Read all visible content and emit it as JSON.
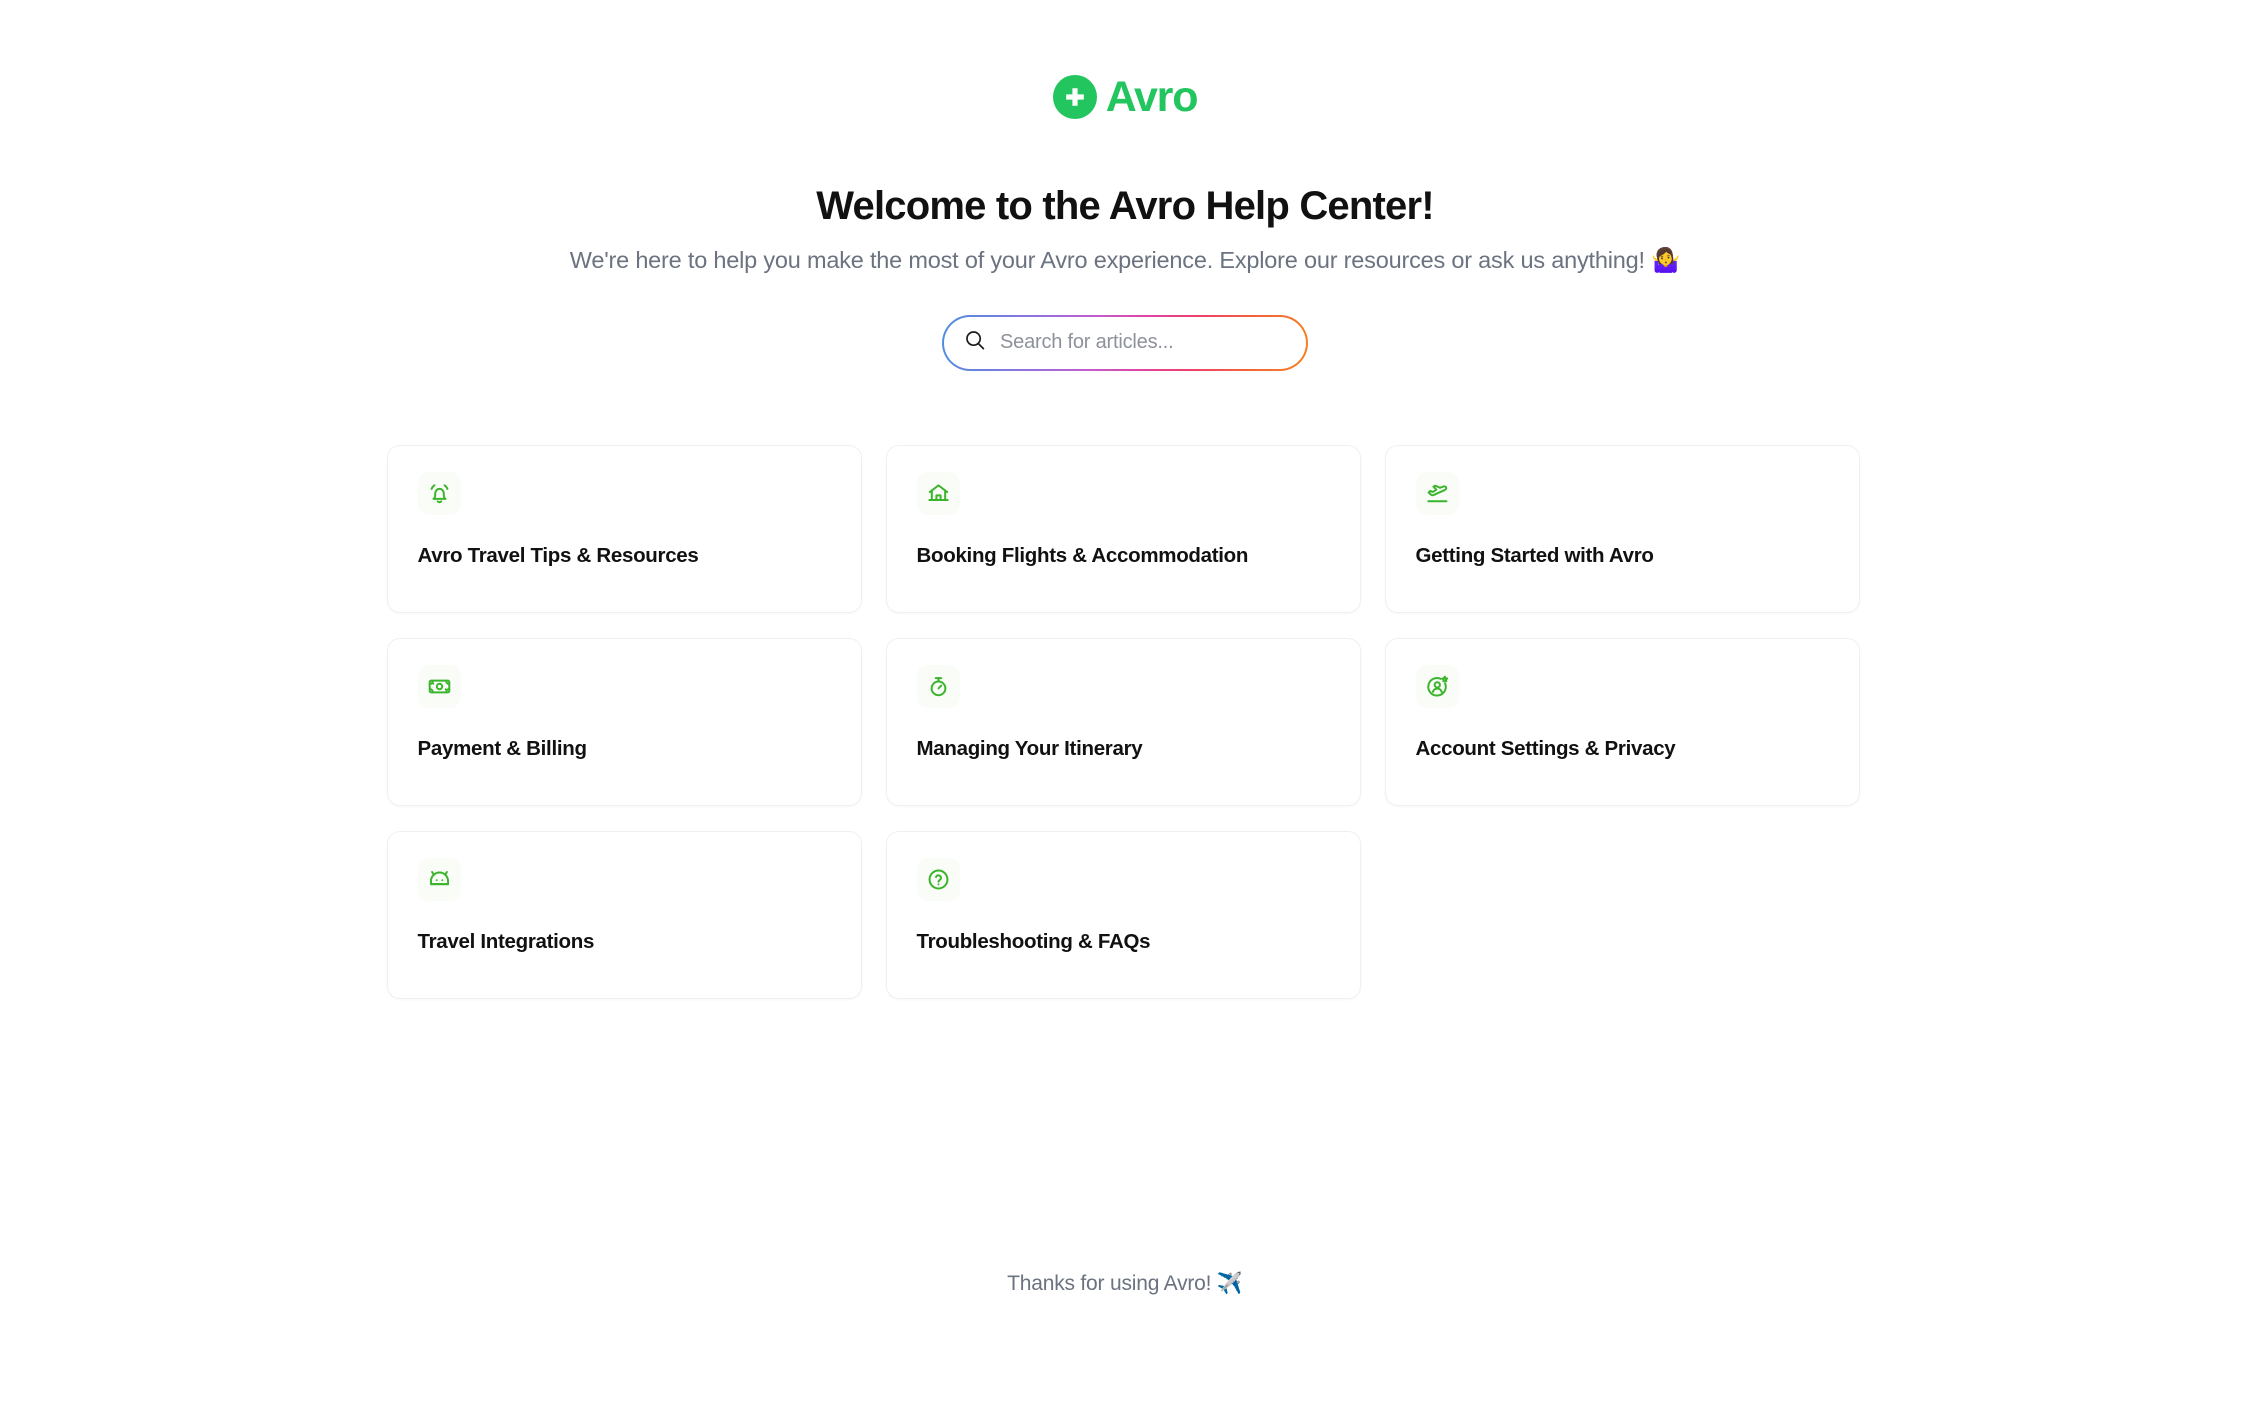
{
  "brand": {
    "name": "Avro",
    "logo_icon": "avro-plus-circle-icon",
    "accent_color": "#22c55e"
  },
  "hero": {
    "title": "Welcome to the Avro Help Center!",
    "subtitle": "We're here to help you make the most of your Avro experience. Explore our resources or ask us anything! 🤷‍♀️"
  },
  "search": {
    "placeholder": "Search for articles...",
    "value": "",
    "icon": "search-icon",
    "border_gradient": [
      "#4f8fe0",
      "#9b6ede",
      "#e0449f",
      "#f58220"
    ]
  },
  "categories": [
    {
      "title": "Avro Travel Tips & Resources",
      "icon": "alarm-bell-icon"
    },
    {
      "title": "Booking Flights & Accommodation",
      "icon": "home-icon"
    },
    {
      "title": "Getting Started with Avro",
      "icon": "plane-takeoff-icon"
    },
    {
      "title": "Payment & Billing",
      "icon": "banknote-icon"
    },
    {
      "title": "Managing Your Itinerary",
      "icon": "stopwatch-icon"
    },
    {
      "title": "Account Settings & Privacy",
      "icon": "user-star-circle-icon"
    },
    {
      "title": "Travel Integrations",
      "icon": "android-robot-icon"
    },
    {
      "title": "Troubleshooting & FAQs",
      "icon": "question-circle-icon"
    }
  ],
  "footer": {
    "text": "Thanks for using Avro! ✈️"
  }
}
